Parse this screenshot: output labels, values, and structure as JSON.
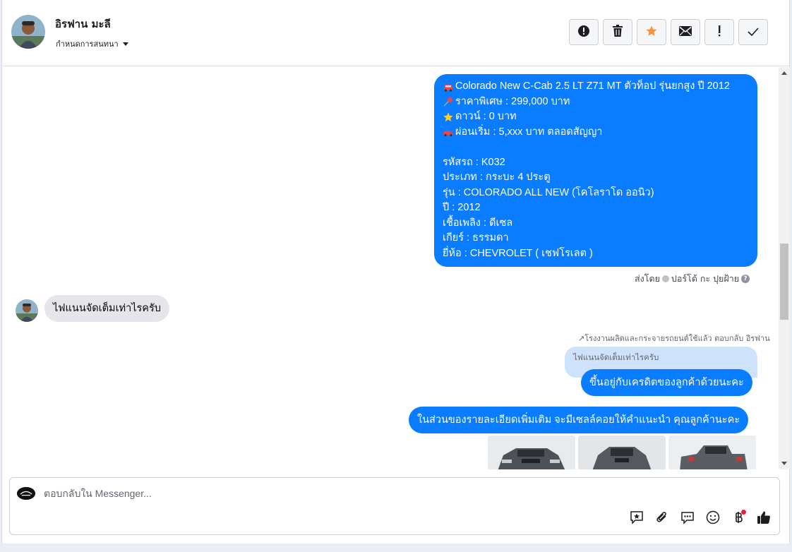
{
  "header": {
    "name": "อิรฟาน มะลี",
    "assign_label": "กำหนดการสนทนา",
    "actions": [
      {
        "icon": "alert-circle-icon"
      },
      {
        "icon": "trash-icon"
      },
      {
        "icon": "star-icon"
      },
      {
        "icon": "mail-icon"
      },
      {
        "icon": "exclamation-icon"
      },
      {
        "icon": "check-icon"
      }
    ]
  },
  "messages": {
    "listing_lines": [
      {
        "emoji": "car-icon",
        "text": "Colorado New C-Cab 2.5 LT Z71 MT ตัวท็อป รุ่นยกสูง ปี 2012"
      },
      {
        "emoji": "pushpin-icon",
        "text": " ราคาพิเศษ : 299,000 บาท"
      },
      {
        "emoji": "star-icon",
        "text": " ดาวน์ : 0 บาท"
      },
      {
        "emoji": "car-icon",
        "text": " ผ่อนเริ่ม : 5,xxx บาท ตลอดสัญญา"
      },
      {
        "emoji": "",
        "text": ""
      },
      {
        "emoji": "",
        "text": "รหัสรถ : K032"
      },
      {
        "emoji": "",
        "text": "ประเภท : กระบะ 4 ประตู"
      },
      {
        "emoji": "",
        "text": "รุ่น : COLORADO ALL NEW (โคโลราโด ออนิว)"
      },
      {
        "emoji": "",
        "text": "ปี : 2012"
      },
      {
        "emoji": "",
        "text": "เชื้อเพลิง : ดีเซล"
      },
      {
        "emoji": "",
        "text": "เกียร์ : ธรรมดา"
      },
      {
        "emoji": "",
        "text": "ยี่ห้อ : CHEVROLET ( เชฟโรเลต )"
      }
    ],
    "sent_by_label": "ส่งโดย",
    "sent_by_name": "ปอร์โต้ กะ ปุยฝ้าย",
    "incoming_text": "ไฟแนนจัดเต็มเท่าไรครับ",
    "reply_meta": "โรงงานผลิตและกระจายรถยนต์ใช้แล้ว ตอบกลับ อิรฟาน",
    "reply_quote": "ไฟแนนจัดเต็มเท่าไรครับ",
    "reply_text": "ขึ้นอยู่กับเครดิตของลูกค้าด้วยนะคะ",
    "info_text": "ในส่วนของรายละเอียดเพิ่มเติม จะมีเซลล์คอยให้คำแนะนำ คุณลูกค้านะคะ"
  },
  "composer": {
    "placeholder": "ตอบกลับใน Messenger...",
    "tools": [
      "saved-reply-icon",
      "paperclip-icon",
      "chat-bubbles-icon",
      "smiley-icon",
      "baht-icon",
      "thumbs-up-icon"
    ]
  },
  "colors": {
    "outgoing_bubble": "#0a7cff",
    "incoming_bubble": "#e4e6eb",
    "quote_bubble": "#cfe2fb"
  }
}
